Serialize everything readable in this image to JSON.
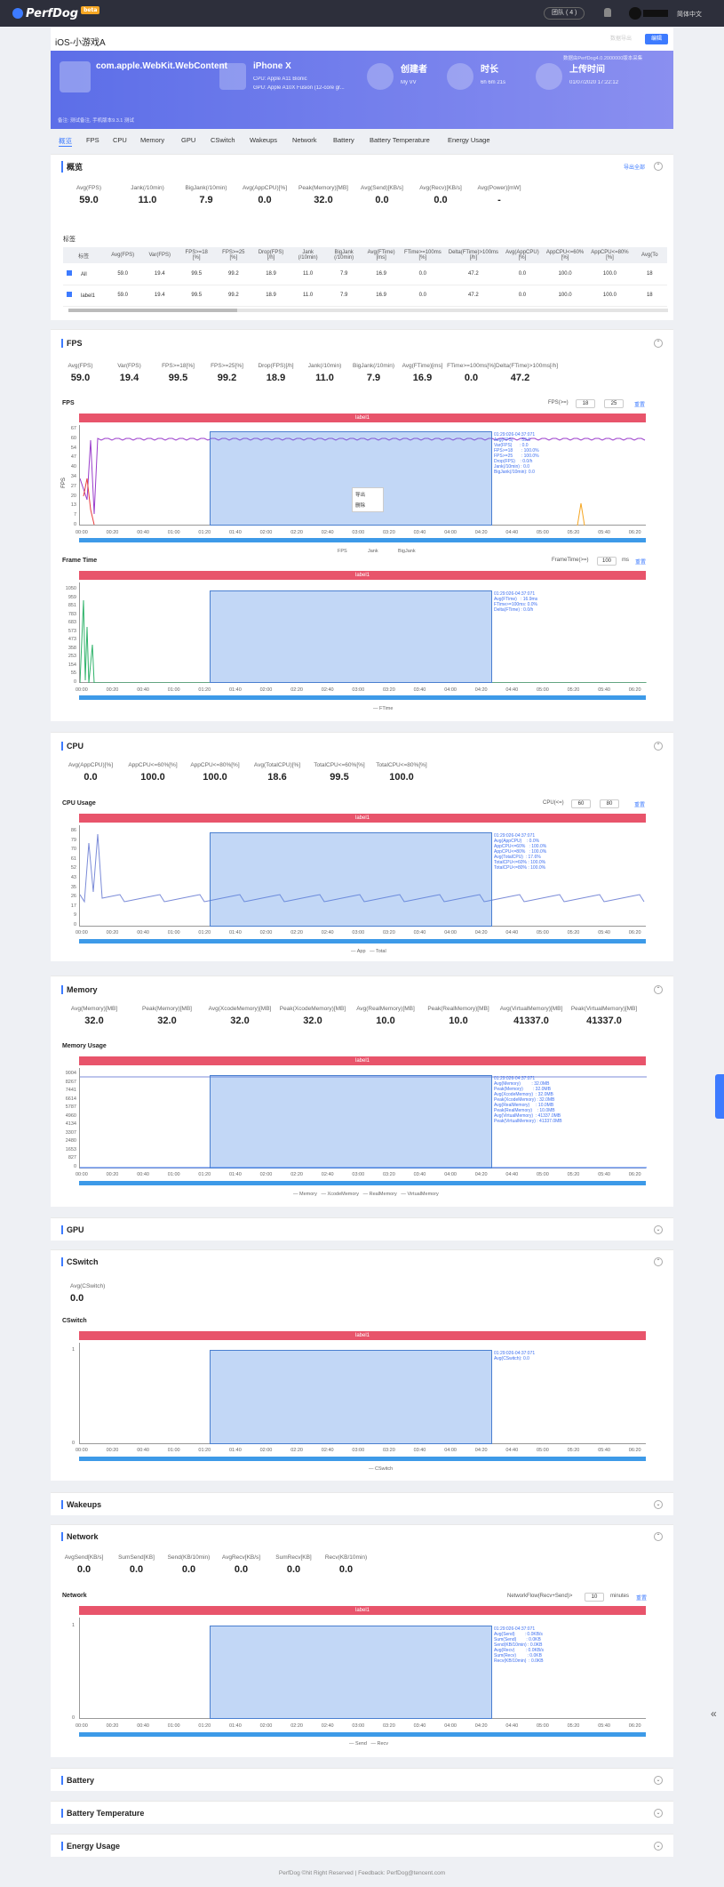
{
  "topbar": {
    "logo": "PerfDog",
    "beta": "beta",
    "group": "团队 ( 4 )",
    "lang": "简体中文"
  },
  "header": {
    "title": "iOS-小游戏A",
    "btn_ghost": "数据导出",
    "btn_save": "编辑"
  },
  "banner": {
    "app_name": "com.apple.WebKit.WebContent",
    "device": "iPhone X",
    "cpu": "CPU: Apple A11 Bionic",
    "gpu": "GPU: Apple A10X Fusion (12-core gr...",
    "creator_label": "创建者",
    "creator": "My VV",
    "duration_label": "时长",
    "duration": "6h 6m 21s",
    "upload_label": "上传时间",
    "upload": "01/07/2020 17:22:12",
    "note": "备注: 测试备注, 手机版本9.3.1 测试",
    "hint": "数据由PerfDog4.0.2000000版本采集"
  },
  "tabs": [
    "概览",
    "FPS",
    "CPU",
    "Memory",
    "GPU",
    "CSwitch",
    "Wakeups",
    "Network",
    "Battery",
    "Battery Temperature",
    "Energy Usage"
  ],
  "overview": {
    "title": "概览",
    "link": "导出全部",
    "stats": [
      {
        "label": "Avg(FPS)",
        "value": "59.0"
      },
      {
        "label": "Jank(/10min)",
        "value": "11.0"
      },
      {
        "label": "BigJank(/10min)",
        "value": "7.9"
      },
      {
        "label": "Avg(AppCPU)[%]",
        "value": "0.0"
      },
      {
        "label": "Peak(Memory)[MB]",
        "value": "32.0"
      },
      {
        "label": "Avg(Send)[KB/s]",
        "value": "0.0"
      },
      {
        "label": "Avg(Recv)[KB/s]",
        "value": "0.0"
      },
      {
        "label": "Avg(Power)[mW]",
        "value": "-"
      }
    ],
    "table_title": "标签",
    "headers": [
      "标签",
      "Avg(FPS)",
      "Var(FPS)",
      "FPS>=18 [%]",
      "FPS>=25 [%]",
      "Drop(FPS) [/h]",
      "Jank (/10min)",
      "BigJank (/10min)",
      "Avg(FTime) [ms]",
      "FTime>=100ms [%]",
      "Delta(FTime)>100ms [/h]",
      "Avg(AppCPU) [%]",
      "AppCPU<=60% [%]",
      "AppCPU<=80% [%]",
      "Avg(To"
    ],
    "rows": [
      [
        "All",
        "59.0",
        "19.4",
        "99.5",
        "99.2",
        "18.9",
        "11.0",
        "7.9",
        "16.9",
        "0.0",
        "47.2",
        "0.0",
        "100.0",
        "100.0",
        "18"
      ],
      [
        "label1",
        "59.0",
        "19.4",
        "99.5",
        "99.2",
        "18.9",
        "11.0",
        "7.9",
        "16.9",
        "0.0",
        "47.2",
        "0.0",
        "100.0",
        "100.0",
        "18"
      ]
    ]
  },
  "fps": {
    "title": "FPS",
    "stats": [
      {
        "label": "Avg(FPS)",
        "value": "59.0"
      },
      {
        "label": "Var(FPS)",
        "value": "19.4"
      },
      {
        "label": "FPS>=18[%]",
        "value": "99.5"
      },
      {
        "label": "FPS>=25[%]",
        "value": "99.2"
      },
      {
        "label": "Drop(FPS)[/h]",
        "value": "18.9"
      },
      {
        "label": "Jank(/10min)",
        "value": "11.0"
      },
      {
        "label": "BigJank(/10min)",
        "value": "7.9"
      },
      {
        "label": "Avg(FTime)[ms]",
        "value": "16.9"
      },
      {
        "label": "FTime>=100ms[%]",
        "value": "0.0"
      },
      {
        "label": "Delta(FTime)>100ms[/h]",
        "value": "47.2"
      }
    ],
    "chart1_label": "FPS",
    "filter_label": "FPS(>=)",
    "filter_a": "18",
    "filter_b": "25",
    "reset": "重置",
    "label_bar": "label1",
    "tooltip": "01:29:026-04:37:071\nAvg(FPS)     : 59.0\nVar(FPS)      : 0.0\nFPS>=18       : 100.0%\nFPS>=25       : 100.0%\nDrop(FPS)    : 0.0/h\nJank(/10min) : 0.0\nBigJank(/10min): 0.0",
    "menu1": "导出",
    "menu2": "删除",
    "chart2_label": "Frame Time",
    "ft_filter": "FrameTime(>=)",
    "ft_val": "100",
    "ft_unit": "ms",
    "tooltip2": "01:29:026-04:37:071\nAvg(FTime)   : 16.9ms\nFTime>=100ms: 0.0%\nDelta(FTime) : 0.0/h",
    "legend1": [
      "FPS",
      "Jank",
      "BigJank"
    ],
    "legend2": "FTime",
    "y1_ticks": [
      "67",
      "60",
      "54",
      "47",
      "40",
      "34",
      "27",
      "20",
      "13",
      "7",
      "0"
    ],
    "y2_ticks": [
      "1050",
      "959",
      "851",
      "783",
      "683",
      "573",
      "473",
      "358",
      "253",
      "154",
      "55",
      "0"
    ],
    "x_ticks": [
      "00:00",
      "00:20",
      "00:40",
      "01:00",
      "01:20",
      "01:40",
      "02:00",
      "02:20",
      "02:40",
      "03:00",
      "03:20",
      "03:40",
      "04:00",
      "04:20",
      "04:40",
      "05:00",
      "05:20",
      "05:40",
      "06:20"
    ]
  },
  "cpu": {
    "title": "CPU",
    "stats": [
      {
        "label": "Avg(AppCPU)[%]",
        "value": "0.0"
      },
      {
        "label": "AppCPU<=60%[%]",
        "value": "100.0"
      },
      {
        "label": "AppCPU<=80%[%]",
        "value": "100.0"
      },
      {
        "label": "Avg(TotalCPU)[%]",
        "value": "18.6"
      },
      {
        "label": "TotalCPU<=60%[%]",
        "value": "99.5"
      },
      {
        "label": "TotalCPU<=80%[%]",
        "value": "100.0"
      }
    ],
    "chart_label": "CPU Usage",
    "filter": "CPU(<=)",
    "a": "60",
    "b": "80",
    "reset": "重置",
    "tooltip": "01:29:026-04:37:071\nAvg(AppCPU)    : 0.0%\nAppCPU<=60%   : 100.0%\nAppCPU<=80%   : 100.0%\nAvg(TotalCPU)  : 17.6%\nTotalCPU<=60% : 100.0%\nTotalCPU<=80% : 100.0%",
    "legend": [
      "App",
      "Total"
    ],
    "y_ticks": [
      "86",
      "79",
      "70",
      "61",
      "52",
      "43",
      "35",
      "26",
      "17",
      "9",
      "0"
    ]
  },
  "memory": {
    "title": "Memory",
    "stats": [
      {
        "label": "Avg(Memory)[MB]",
        "value": "32.0"
      },
      {
        "label": "Peak(Memory)[MB]",
        "value": "32.0"
      },
      {
        "label": "Avg(XcodeMemory)[MB]",
        "value": "32.0"
      },
      {
        "label": "Peak(XcodeMemory)[MB]",
        "value": "32.0"
      },
      {
        "label": "Avg(RealMemory)[MB]",
        "value": "10.0"
      },
      {
        "label": "Peak(RealMemory)[MB]",
        "value": "10.0"
      },
      {
        "label": "Avg(VirtualMemory)[MB]",
        "value": "41337.0"
      },
      {
        "label": "Peak(VirtualMemory)[MB]",
        "value": "41337.0"
      }
    ],
    "chart_label": "Memory Usage",
    "tooltip": "01:29:026-04:37:071\nAvg(Memory)         : 32.0MB\nPeak(Memory)        : 32.0MB\nAvg(XcodeMemory)  : 32.0MB\nPeak(XcodeMemory) : 32.0MB\nAvg(RealMemory)     : 10.0MB\nPeak(RealMemory)    : 10.0MB\nAvg(VirtualMemory)  : 41337.0MB\nPeak(VirtualMemory) : 41337.0MB",
    "legend": [
      "Memory",
      "XcodeMemory",
      "RealMemory",
      "VirtualMemory"
    ],
    "y_ticks": [
      "9004",
      "8267",
      "7441",
      "6614",
      "5787",
      "4960",
      "4134",
      "3307",
      "2480",
      "1653",
      "827",
      "0"
    ]
  },
  "gpu": {
    "title": "GPU"
  },
  "cswitch": {
    "title": "CSwitch",
    "stats": [
      {
        "label": "Avg(CSwitch)",
        "value": "0.0"
      }
    ],
    "chart_label": "CSwitch",
    "tooltip": "01:29:026-04:37:071\nAvg(CSwitch): 0.0",
    "legend": "CSwitch",
    "y_ticks": [
      "1",
      "0"
    ]
  },
  "wakeups": {
    "title": "Wakeups"
  },
  "network": {
    "title": "Network",
    "stats": [
      {
        "label": "AvgSend[KB/s]",
        "value": "0.0"
      },
      {
        "label": "SumSend[KB]",
        "value": "0.0"
      },
      {
        "label": "Send(KB/10min)",
        "value": "0.0"
      },
      {
        "label": "AvgRecv[KB/s]",
        "value": "0.0"
      },
      {
        "label": "SumRecv[KB]",
        "value": "0.0"
      },
      {
        "label": "Recv(KB/10min)",
        "value": "0.0"
      }
    ],
    "chart_label": "Network",
    "filter": "NetworkFlow(Recv+Send)>",
    "val": "10",
    "unit": "minutes",
    "reset": "重置",
    "tooltip": "01:29:026-04:37:071\nAvg(Send)        : 0.0KB/s\nSum(Send)        : 0.0KB\nSend(KB/10min) : 0.0KB\nAvg(Recv)         : 0.0KB/s\nSum(Recv)         : 0.0KB\nRecv(KB/10min)  : 0.0KB",
    "legend": [
      "Send",
      "Recv"
    ],
    "y_ticks": [
      "1",
      "0"
    ]
  },
  "battery": {
    "title": "Battery"
  },
  "battery_temp": {
    "title": "Battery Temperature"
  },
  "energy": {
    "title": "Energy Usage"
  },
  "footer": "PerfDog ©hit Right Reserved | Feedback: PerfDog@tencent.com",
  "colors": {
    "accent": "#3d7bff",
    "label_bar": "#e8546b",
    "selection": "#508ce6",
    "fps_line": "#9b3dcb",
    "jank": "#e84040",
    "ftime": "#2fb36a"
  }
}
